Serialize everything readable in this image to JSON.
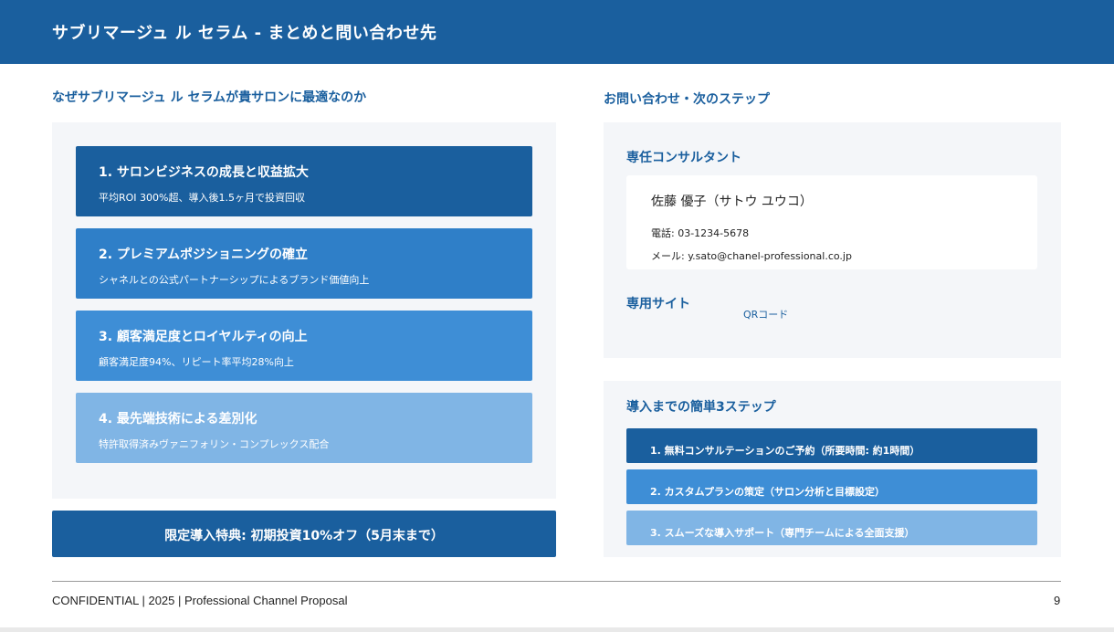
{
  "header": {
    "title": "サブリマージュ ル セラム - まとめと問い合わせ先"
  },
  "left": {
    "heading": "なぜサブリマージュ ル セラムが貴サロンに最適なのか",
    "benefits": [
      {
        "title": "1. サロンビジネスの成長と収益拡大",
        "desc": "平均ROI 300%超、導入後1.5ヶ月で投資回収"
      },
      {
        "title": "2. プレミアムポジショニングの確立",
        "desc": "シャネルとの公式パートナーシップによるブランド価値向上"
      },
      {
        "title": "3. 顧客満足度とロイヤルティの向上",
        "desc": "顧客満足度94%、リピート率平均28%向上"
      },
      {
        "title": "4. 最先端技術による差別化",
        "desc": "特許取得済みヴァニフォリン・コンプレックス配合"
      }
    ],
    "offer": "限定導入特典: 初期投資10%オフ（5月末まで）"
  },
  "right": {
    "heading": "お問い合わせ・次のステップ",
    "consultant": {
      "label": "専任コンサルタント",
      "name": "佐藤 優子（サトウ ユウコ）",
      "phone": "電話: 03-1234-5678",
      "email": "メール: y.sato@chanel-professional.co.jp"
    },
    "site": {
      "label": "専用サイト",
      "qr_label": "QRコード"
    },
    "steps": {
      "heading": "導入までの簡単3ステップ",
      "items": [
        "1. 無料コンサルテーションのご予約（所要時間: 約1時間）",
        "2. カスタムプランの策定（サロン分析と目標設定）",
        "3. スムーズな導入サポート（専門チームによる全面支援）"
      ]
    }
  },
  "footer": {
    "left": "CONFIDENTIAL | 2025 | Professional Channel Proposal",
    "page": "9"
  },
  "colors": {
    "primary": "#1a5f9e",
    "blue2": "#2f7fc8",
    "blue3": "#3e8ed6",
    "blue4": "#80b5e5",
    "panel_bg": "#f4f6f9"
  }
}
